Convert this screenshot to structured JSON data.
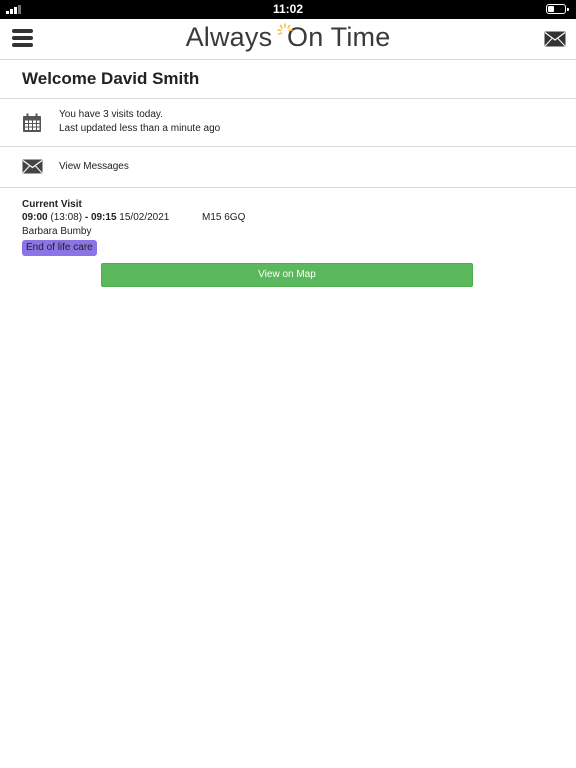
{
  "status_bar": {
    "time": "11:02"
  },
  "header": {
    "logo_part1": "Always",
    "logo_part2": "On Time",
    "menu_icon": "hamburger-icon",
    "mail_icon": "envelope-icon"
  },
  "welcome": {
    "title": "Welcome David Smith"
  },
  "summary": {
    "visits_text": "You have 3 visits today.",
    "updated_text": "Last updated less than a minute ago",
    "icon": "calendar-icon"
  },
  "messages": {
    "label": "View Messages",
    "icon": "envelope-icon"
  },
  "current_visit": {
    "title": "Current Visit",
    "start": "09:00",
    "actual_start": "(13:08)",
    "separator": " - ",
    "end": "09:15",
    "date": "15/02/2021",
    "postcode": "M15 6GQ",
    "client": "Barbara Bumby",
    "care_type": "End of life care",
    "map_button": "View on Map"
  },
  "colors": {
    "badge": "#8a74e6",
    "button": "#5cb85c",
    "logo_sun": "#f2c23a"
  }
}
